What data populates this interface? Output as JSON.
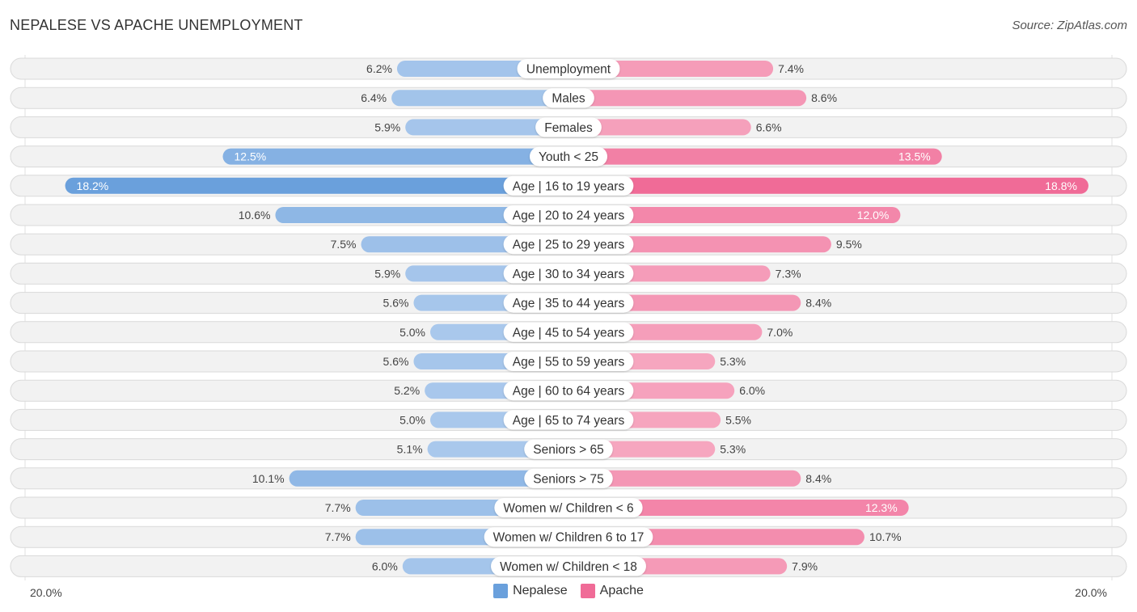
{
  "header": {
    "title": "NEPALESE VS APACHE UNEMPLOYMENT",
    "source": "Source: ZipAtlas.com"
  },
  "colors": {
    "nepalese": "#6aa0dc",
    "nepalese_light": "#a9c8ec",
    "apache": "#f06b97",
    "apache_light": "#f6a7c0"
  },
  "chart_data": {
    "type": "bar",
    "orientation": "horizontal-diverging",
    "title": "NEPALESE VS APACHE UNEMPLOYMENT",
    "categories": [
      "Unemployment",
      "Males",
      "Females",
      "Youth < 25",
      "Age | 16 to 19 years",
      "Age | 20 to 24 years",
      "Age | 25 to 29 years",
      "Age | 30 to 34 years",
      "Age | 35 to 44 years",
      "Age | 45 to 54 years",
      "Age | 55 to 59 years",
      "Age | 60 to 64 years",
      "Age | 65 to 74 years",
      "Seniors > 65",
      "Seniors > 75",
      "Women w/ Children < 6",
      "Women w/ Children 6 to 17",
      "Women w/ Children < 18"
    ],
    "series": [
      {
        "name": "Nepalese",
        "side": "left",
        "values": [
          6.2,
          6.4,
          5.9,
          12.5,
          18.2,
          10.6,
          7.5,
          5.9,
          5.6,
          5.0,
          5.6,
          5.2,
          5.0,
          5.1,
          10.1,
          7.7,
          7.7,
          6.0
        ],
        "labels": [
          "6.2%",
          "6.4%",
          "5.9%",
          "12.5%",
          "18.2%",
          "10.6%",
          "7.5%",
          "5.9%",
          "5.6%",
          "5.0%",
          "5.6%",
          "5.2%",
          "5.0%",
          "5.1%",
          "10.1%",
          "7.7%",
          "7.7%",
          "6.0%"
        ]
      },
      {
        "name": "Apache",
        "side": "right",
        "values": [
          7.4,
          8.6,
          6.6,
          13.5,
          18.8,
          12.0,
          9.5,
          7.3,
          8.4,
          7.0,
          5.3,
          6.0,
          5.5,
          5.3,
          8.4,
          12.3,
          10.7,
          7.9
        ],
        "labels": [
          "7.4%",
          "8.6%",
          "6.6%",
          "13.5%",
          "18.8%",
          "12.0%",
          "9.5%",
          "7.3%",
          "8.4%",
          "7.0%",
          "5.3%",
          "6.0%",
          "5.5%",
          "5.3%",
          "8.4%",
          "12.3%",
          "10.7%",
          "7.9%"
        ]
      }
    ],
    "unit": "%",
    "xlim": [
      -20,
      20
    ],
    "axis_labels": {
      "left": "20.0%",
      "right": "20.0%"
    },
    "legend": {
      "position": "bottom-center",
      "entries": [
        "Nepalese",
        "Apache"
      ]
    },
    "grid": false
  }
}
